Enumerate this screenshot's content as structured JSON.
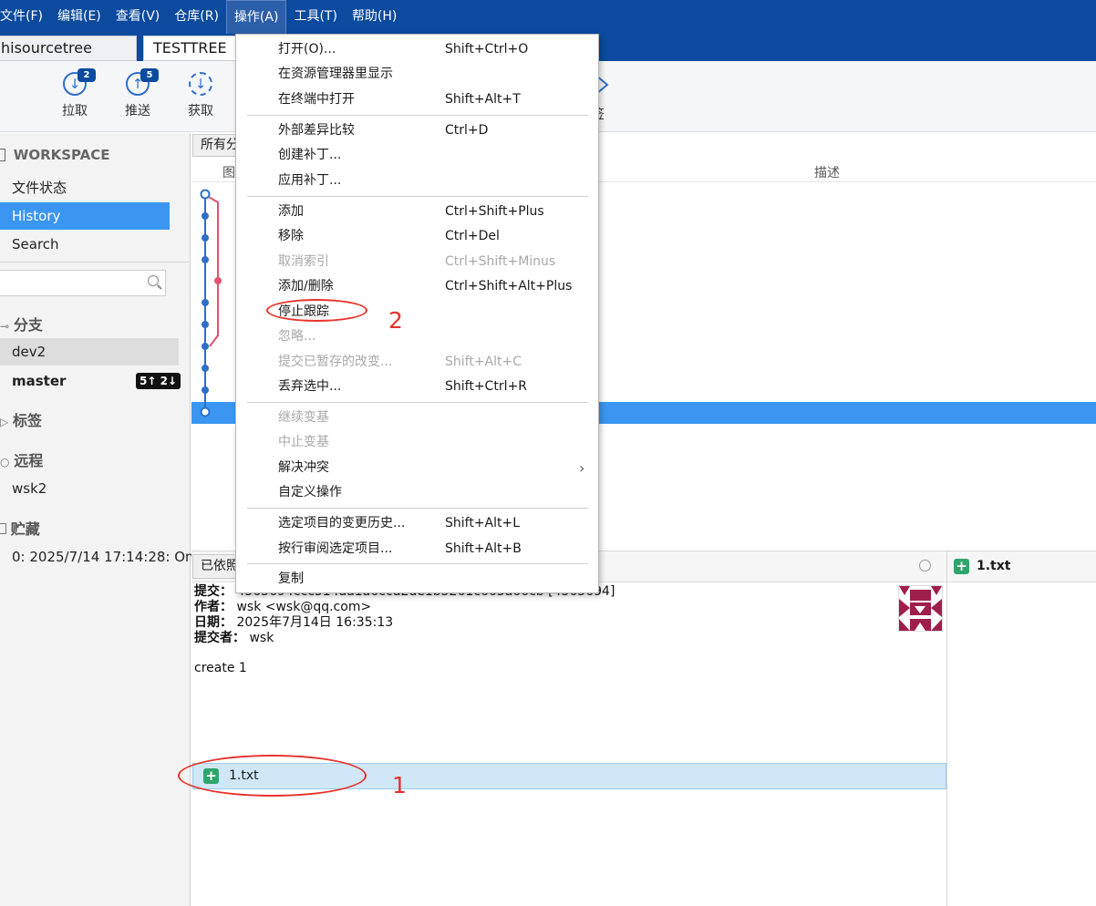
{
  "menubar": {
    "items": [
      "文件(F)",
      "编辑(E)",
      "查看(V)",
      "仓库(R)",
      "操作(A)",
      "工具(T)",
      "帮助(H)"
    ]
  },
  "tabs": [
    "hisourcetree",
    "TESTTREE"
  ],
  "toolbar": {
    "pull": {
      "label": "拉取",
      "badge": "2"
    },
    "push": {
      "label": "推送",
      "badge": "5"
    },
    "fetch": {
      "label": "获取"
    },
    "tag_partial": "签"
  },
  "sidebar": {
    "workspace": "WORKSPACE",
    "items": [
      "文件状态",
      "History",
      "Search"
    ],
    "branches_title": "分支",
    "branches": [
      {
        "name": "dev2"
      },
      {
        "name": "master",
        "badge": "5↑ 2↓"
      }
    ],
    "tags_title": "标签",
    "remotes_title": "远程",
    "remotes": [
      "wsk2"
    ],
    "stashes_title": "贮藏",
    "stashes": [
      "0: 2025/7/14 17:14:28: On"
    ]
  },
  "graph": {
    "branch_filter": "所有分",
    "col_graph": "图",
    "col_desc": "描述",
    "branch_colors": {
      "main": "#2f6fc9",
      "side": "#e0536c"
    }
  },
  "details": {
    "combo": "已依照",
    "commit_label": "提交：",
    "commit_value": "4565694ccc514aa1a6ccd2de1b5261c663a66cb [4565694]",
    "author_label": "作者：",
    "author_value": "wsk <wsk@qq.com>",
    "date_label": "日期：",
    "date_value": "2025年7月14日 16:35:13",
    "committer_label": "提交者：",
    "committer_value": "wsk",
    "message": "create 1",
    "file": "1.txt"
  },
  "right_pane": {
    "file": "1.txt"
  },
  "menu": {
    "items": [
      {
        "label": "打开(O)...",
        "shortcut": "Shift+Ctrl+O"
      },
      {
        "label": "在资源管理器里显示",
        "shortcut": ""
      },
      {
        "label": "在终端中打开",
        "shortcut": "Shift+Alt+T"
      },
      {
        "label": "外部差异比较",
        "shortcut": "Ctrl+D"
      },
      {
        "label": "创建补丁...",
        "shortcut": ""
      },
      {
        "label": "应用补丁...",
        "shortcut": ""
      },
      {
        "label": "添加",
        "shortcut": "Ctrl+Shift+Plus"
      },
      {
        "label": "移除",
        "shortcut": "Ctrl+Del"
      },
      {
        "label": "取消索引",
        "shortcut": "Ctrl+Shift+Minus"
      },
      {
        "label": "添加/删除",
        "shortcut": "Ctrl+Shift+Alt+Plus"
      },
      {
        "label": "停止跟踪",
        "shortcut": ""
      },
      {
        "label": "忽略...",
        "shortcut": ""
      },
      {
        "label": "提交已暂存的改变...",
        "shortcut": "Shift+Alt+C"
      },
      {
        "label": "丢弃选中...",
        "shortcut": "Shift+Ctrl+R"
      },
      {
        "label": "继续变基",
        "shortcut": ""
      },
      {
        "label": "中止变基",
        "shortcut": ""
      },
      {
        "label": "解决冲突",
        "shortcut": ""
      },
      {
        "label": "自定义操作",
        "shortcut": ""
      },
      {
        "label": "选定项目的变更历史...",
        "shortcut": "Shift+Alt+L"
      },
      {
        "label": "按行审阅选定项目...",
        "shortcut": "Shift+Alt+B"
      },
      {
        "label": "复制",
        "shortcut": ""
      }
    ]
  },
  "annotations": {
    "one": "1",
    "two": "2",
    "color": "#e8322b"
  }
}
